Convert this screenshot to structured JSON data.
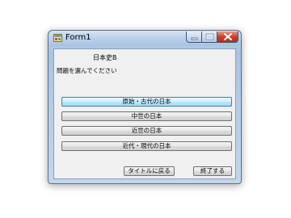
{
  "window": {
    "title": "Form1",
    "app_icon": "form-app-icon",
    "controls": {
      "minimize_icon": "minimize-icon",
      "maximize_icon": "maximize-icon",
      "close_icon": "close-icon"
    }
  },
  "form": {
    "subject_label": "日本史B",
    "prompt_label": "問題を選んでください",
    "era_buttons": [
      {
        "label": "原始・古代の日本"
      },
      {
        "label": "中世の日本"
      },
      {
        "label": "近世の日本"
      },
      {
        "label": "近代・現代の日本"
      }
    ],
    "back_button_label": "タイトルに戻る",
    "exit_button_label": "終了する"
  },
  "colors": {
    "title_bar": "#bcd2ea",
    "close_button": "#c9412b",
    "focused_button_border": "#3c7fb1",
    "client_background": "#f0f0f0"
  }
}
